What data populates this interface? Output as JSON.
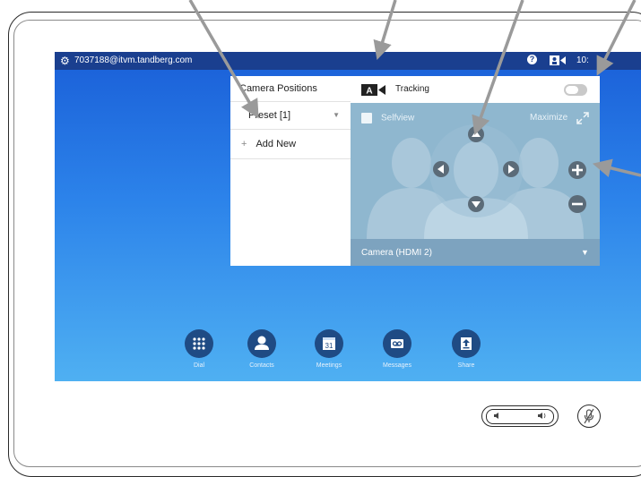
{
  "status_bar": {
    "account": "7037188@itvm.tandberg.com",
    "time": "10:"
  },
  "camera_positions": {
    "title": "Camera Positions",
    "preset_label": "Preset [1]",
    "add_new_label": "Add New"
  },
  "camera_control": {
    "tracking_label": "Tracking",
    "tracking_badge": "A",
    "tracking_enabled": false,
    "selfview_label": "Selfview",
    "maximize_label": "Maximize",
    "camera_source": "Camera (HDMI 2)"
  },
  "dock": [
    {
      "label": "Dial",
      "icon": "dial-pad-icon"
    },
    {
      "label": "Contacts",
      "icon": "person-icon"
    },
    {
      "label": "Meetings",
      "icon": "calendar-icon",
      "day": "31"
    },
    {
      "label": "Messages",
      "icon": "voicemail-icon"
    },
    {
      "label": "Share",
      "icon": "upload-icon"
    }
  ],
  "colors": {
    "status_bar": "#1a3f8f",
    "screen_top": "#1a5fd8",
    "screen_bottom": "#4fb0f2",
    "control_panel": "#8fb7cf",
    "dock_button": "#1f4b84",
    "callout_arrow": "#9a9a9a"
  }
}
